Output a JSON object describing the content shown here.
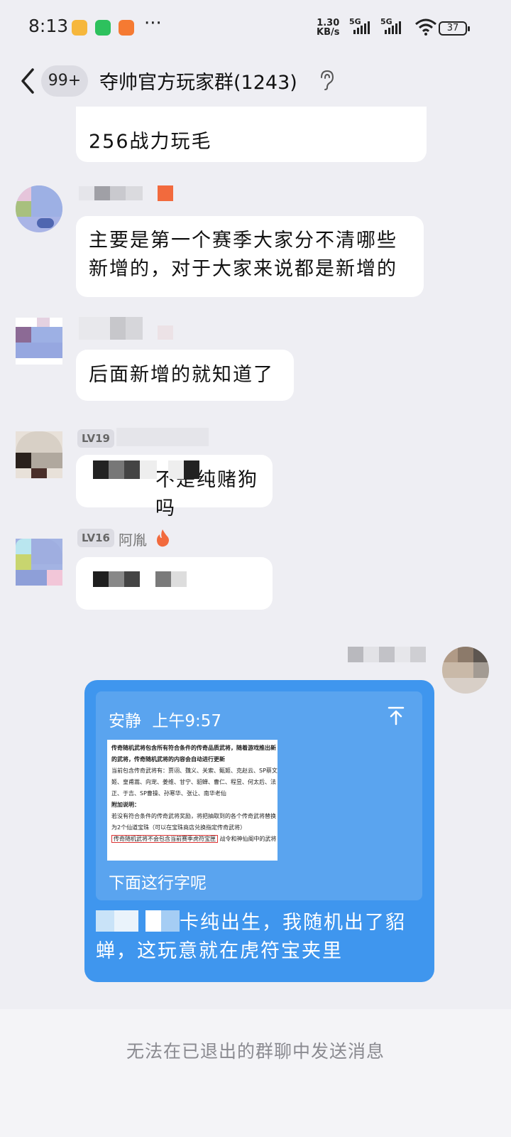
{
  "status_bar": {
    "time": "8:13",
    "dots": "···",
    "net_speed_value": "1.30",
    "net_speed_unit": "KB/s",
    "sim1": "5G",
    "sim2": "5G",
    "battery": "37"
  },
  "header": {
    "unread_badge": "99+",
    "title": "夺帅官方玩家群(1243)"
  },
  "messages": [
    {
      "text": "256战力玩毛"
    },
    {
      "text": "主要是第一个赛季大家分不清哪些新增的，对于大家来说都是新增的"
    },
    {
      "text": "后面新增的就知道了"
    },
    {
      "level": "LV19",
      "text": "不是纯赌狗吗"
    },
    {
      "level": "LV16",
      "nickname": "阿胤"
    }
  ],
  "my_message": {
    "quote_author": "安静",
    "quote_time": "上午9:57",
    "quote_caption": "下面这行字呢",
    "quote_image_lines": [
      "传奇随机武将包含所有符合条件的传奇品质武将，随着游戏推出新",
      "的武将，传奇随机武将的内容会自动进行更新",
      "当前包含传奇武将有：贾诩、魏义、关索、甄姬、克赵云、SP蔡文",
      "姬、皇甫嵩、向宠、姜维、甘宁、貂蝉、曹仁、程昱、何太后、法",
      "正、于吉、SP曹操、孙寒华、张让、南华老仙",
      "附加说明：",
      "若没有符合条件的传奇武将奖励，将把抽取到的各个传奇武将替换",
      "为2个仙道宝珠（可以在宝珠商店兑换指定传奇武将）",
      "传奇随机武将不会包含当前赛季虎符宝匣",
      "战令和神仙阁中的武将"
    ],
    "text": "卡纯出生，我随机出了貂蝉，这玩意就在虎符宝夹里"
  },
  "bottom_notice": "无法在已退出的群聊中发送消息",
  "colors": {
    "background": "#eeeef3",
    "my_bubble": "#3f96ee",
    "quote_box": "#5aa4ef",
    "fire_badge": "#f26a3d"
  }
}
